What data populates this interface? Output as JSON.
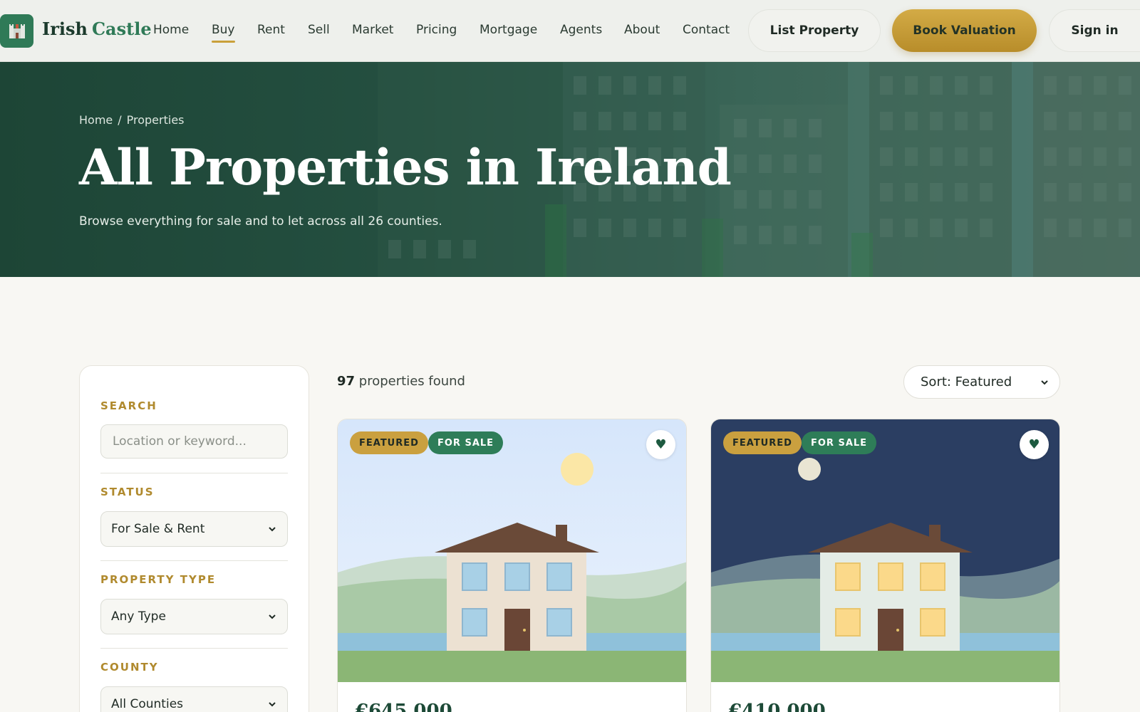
{
  "brand": {
    "word1": "Irish",
    "word2": "Castle",
    "logo_icon": "castle-icon"
  },
  "nav": {
    "links": [
      {
        "label": "Home",
        "active": false
      },
      {
        "label": "Buy",
        "active": true
      },
      {
        "label": "Rent",
        "active": false
      },
      {
        "label": "Sell",
        "active": false
      },
      {
        "label": "Market",
        "active": false
      },
      {
        "label": "Pricing",
        "active": false
      },
      {
        "label": "Mortgage",
        "active": false
      },
      {
        "label": "Agents",
        "active": false
      },
      {
        "label": "About",
        "active": false
      },
      {
        "label": "Contact",
        "active": false
      }
    ],
    "list_property": "List Property",
    "book_valuation": "Book Valuation",
    "sign_in": "Sign in"
  },
  "hero": {
    "breadcrumb": [
      "Home",
      "Properties"
    ],
    "breadcrumb_sep": "/",
    "title": "All Properties in Ireland",
    "subtitle": "Browse everything for sale and to let across all 26 counties."
  },
  "filters": {
    "search_label": "SEARCH",
    "search_placeholder": "Location or keyword...",
    "search_value": "",
    "status_label": "STATUS",
    "status_value": "For Sale & Rent",
    "type_label": "PROPERTY TYPE",
    "type_value": "Any Type",
    "county_label": "COUNTY",
    "county_value": "All Counties"
  },
  "results": {
    "count": "97",
    "count_suffix": "properties found",
    "sort_value": "Sort: Featured"
  },
  "colors": {
    "brand_green": "#2f7a57",
    "accent_gold": "#c9a03a",
    "hero_green": "#1d4536"
  },
  "listings": [
    {
      "badges": [
        "FEATURED",
        "FOR SALE"
      ],
      "price": "€645,000",
      "scene": "day",
      "favorite_icon": "heart-icon"
    },
    {
      "badges": [
        "FEATURED",
        "FOR SALE"
      ],
      "price": "€410,000",
      "scene": "night",
      "favorite_icon": "heart-icon"
    }
  ]
}
